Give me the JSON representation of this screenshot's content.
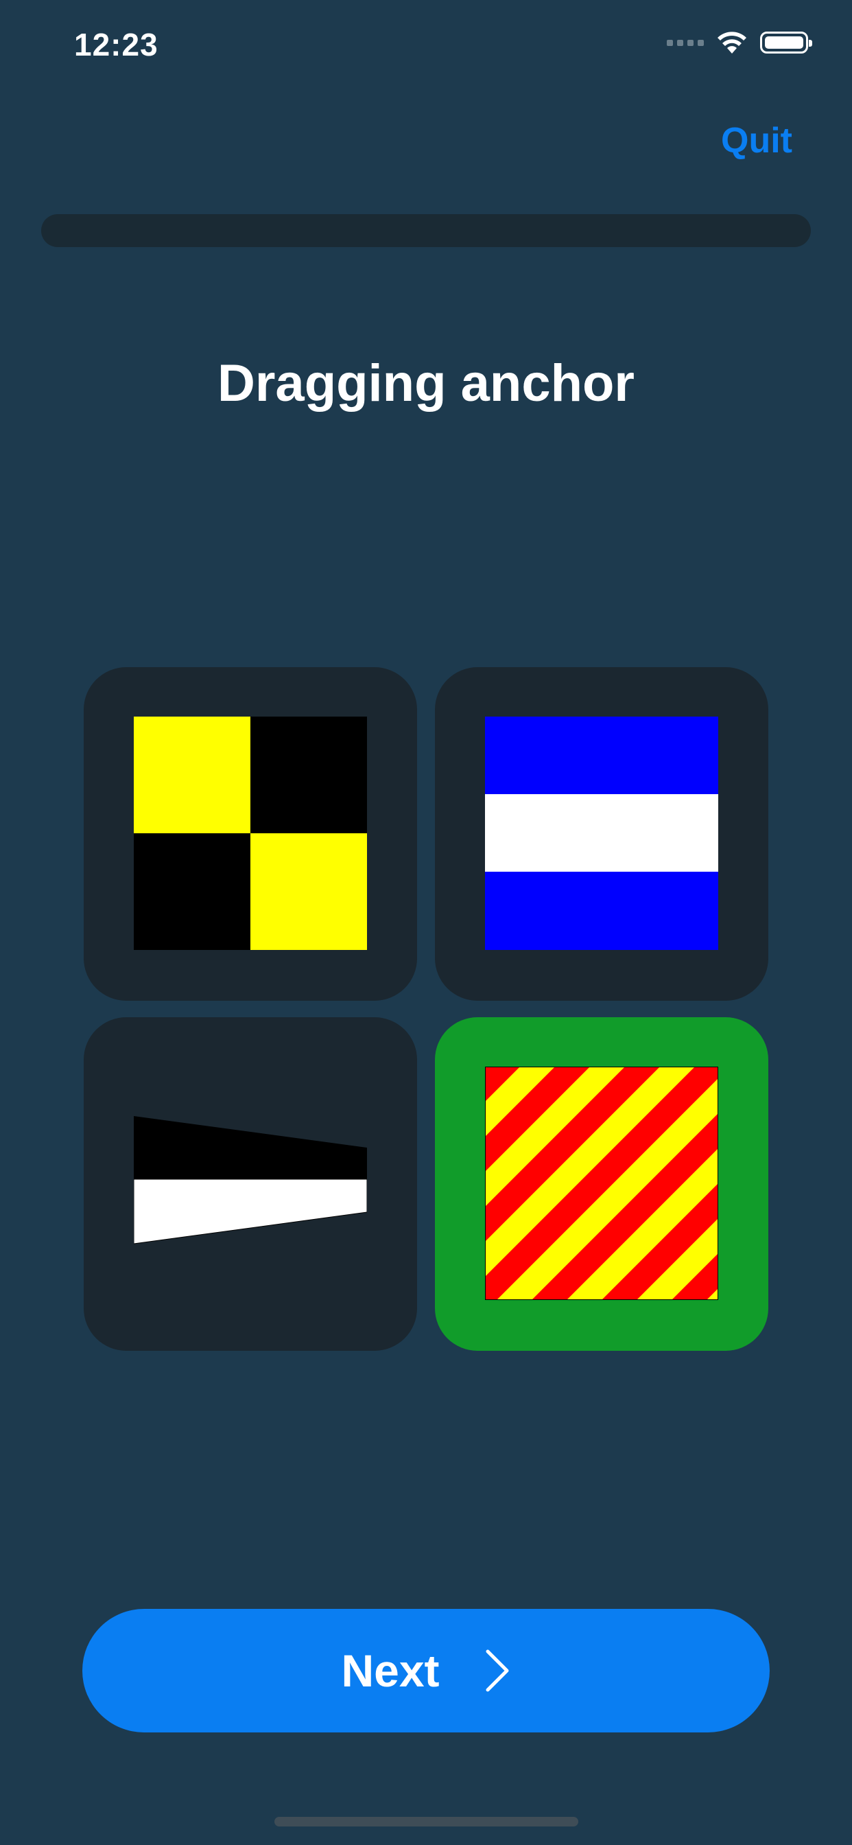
{
  "status_bar": {
    "time": "12:23",
    "icons": [
      "cellular-signal-icon",
      "wifi-icon",
      "battery-icon"
    ]
  },
  "header": {
    "quit_label": "Quit"
  },
  "progress": {
    "fraction": 0
  },
  "question": {
    "prompt": "Dragging anchor"
  },
  "options": [
    {
      "flag": "L",
      "colors": [
        "#ffff00",
        "#000000"
      ],
      "state": "default"
    },
    {
      "flag": "J",
      "colors": [
        "#0000ff",
        "#ffffff"
      ],
      "state": "default"
    },
    {
      "flag": "answering-pennant-black-white",
      "colors": [
        "#000000",
        "#ffffff"
      ],
      "state": "default"
    },
    {
      "flag": "Y",
      "colors": [
        "#ffff00",
        "#ff0000"
      ],
      "state": "correct"
    }
  ],
  "footer": {
    "next_label": "Next",
    "next_icon": "chevron-right-icon"
  },
  "colors": {
    "background": "#1d3a4e",
    "tile": "#1b2730",
    "correct": "#119c2a",
    "accent": "#0a7ef2"
  }
}
